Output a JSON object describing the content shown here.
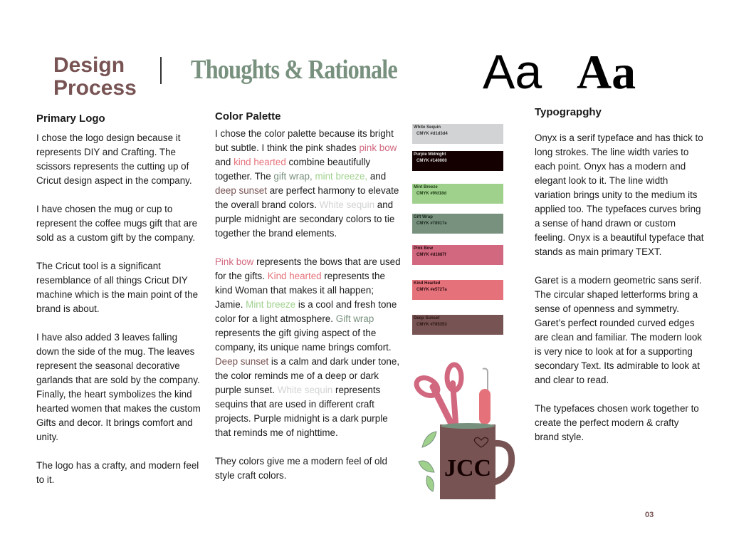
{
  "header": {
    "title_line1": "Design",
    "title_line2": "Process",
    "subtitle": "Thoughts & Rationale",
    "type_sample_sans": "Aa",
    "type_sample_serif": "Aa"
  },
  "primary_logo": {
    "heading": "Primary Logo",
    "paragraphs": [
      [
        {
          "t": "I chose the logo design because it represents DIY and Crafting. The scissors represents the cutting up of Cricut design aspect in the company."
        }
      ],
      [
        {
          "t": "I have chosen the mug or cup to represent the coffee mugs gift that are sold as a custom gift by the company."
        }
      ],
      [
        {
          "t": "The Cricut tool is a significant resemblance of all things Cricut DIY machine which is the main point of the brand is about."
        }
      ],
      [
        {
          "t": " I have also added 3 leaves falling down the side of the mug. The leaves represent the seasonal decorative garlands that are sold by the company. Finally, the heart symbolizes the kind hearted women that makes the custom Gifts and decor. It brings comfort and unity."
        }
      ],
      [
        {
          "t": "The logo has a crafty, and modern feel to it."
        }
      ]
    ]
  },
  "color_palette": {
    "heading": "Color Palette",
    "paragraphs": [
      [
        {
          "t": "I chose the color palette because its bright but subtle. I think the pink shades "
        },
        {
          "t": "pink bow",
          "c": "#d1687f"
        },
        {
          "t": " and "
        },
        {
          "t": "kind hearted",
          "c": "#e5727a"
        },
        {
          "t": " combine beautifully together. The "
        },
        {
          "t": "gift wrap,",
          "c": "#78917e"
        },
        {
          "t": " "
        },
        {
          "t": "mint breeze,",
          "c": "#9fd18d"
        },
        {
          "t": " and "
        },
        {
          "t": "deep sunset",
          "c": "#785353"
        },
        {
          "t": " are perfect harmony to elevate the overall brand colors. "
        },
        {
          "t": "White sequin",
          "c": "#d1d3d4"
        },
        {
          "t": " and purple midnight are secondary colors to tie together the brand elements."
        }
      ],
      [
        {
          "t": "Pink bow",
          "c": "#d1687f"
        },
        {
          "t": " represents the bows that are used for the gifts. "
        },
        {
          "t": "Kind hearted",
          "c": "#e5727a"
        },
        {
          "t": " represents the kind Woman that makes it all happen; Jamie. "
        },
        {
          "t": "Mint breeze",
          "c": "#9fd18d"
        },
        {
          "t": " is a cool and fresh tone color for a light atmosphere. "
        },
        {
          "t": "Gift wrap",
          "c": "#78917e"
        },
        {
          "t": " represents the gift giving aspect of the company, its unique name brings comfort. "
        },
        {
          "t": "Deep sunset",
          "c": "#785353"
        },
        {
          "t": " is a calm and dark under tone, the color reminds me of a deep or dark purple sunset. "
        },
        {
          "t": "White sequin",
          "c": "#d1d3d4"
        },
        {
          "t": " represents sequins that are used in different craft projects. Purple midnight is a dark purple that reminds me of nighttime."
        }
      ],
      [
        {
          "t": "They colors give me a modern feel of old style craft colors."
        }
      ]
    ]
  },
  "swatches": [
    {
      "name": "White Sequin",
      "code": "CMYK #d1d3d4",
      "color": "#d1d3d4",
      "text": "#333333"
    },
    {
      "name": "Purple Midnight",
      "code": "CMYK #140000",
      "color": "#140000",
      "text": "#e0e0e0"
    },
    {
      "name": "Mint Breeze",
      "code": "CMYK #9fd18d",
      "color": "#9fd18d",
      "text": "#1c3a12"
    },
    {
      "name": "Gift Wrap",
      "code": "CMYK #78917e",
      "color": "#78917e",
      "text": "#1c2a20"
    },
    {
      "name": "Pink Bow",
      "code": "CMYK #d1687f",
      "color": "#d1687f",
      "text": "#2a0a10"
    },
    {
      "name": "Kind Hearted",
      "code": "CMYK #e5727a",
      "color": "#e5727a",
      "text": "#2a0a10"
    },
    {
      "name": "Deep Sunset",
      "code": "CMYK #785353",
      "color": "#785353",
      "text": "#2a1414"
    }
  ],
  "logo": {
    "lettering": "JCC"
  },
  "typography": {
    "heading": "Typograpghy",
    "paragraphs": [
      [
        {
          "t": "Onyx is a serif typeface and has thick to long strokes. The line width varies to each point. Onyx has a modern and elegant look to it. The line width variation brings unity to the medium its applied too. The typefaces curves bring a sense of hand drawn or custom feeling. Onyx is a beautiful typeface that stands as main primary TEXT."
        }
      ],
      [
        {
          "t": "Garet is a modern geometric sans serif.  The circular shaped letterforms bring a sense of openness and symmetry. Garet’s perfect rounded curved edges are clean and familiar. The modern look is very nice to look at for a supporting secondary Text. Its admirable to look at and clear to read."
        }
      ],
      [
        {
          "t": "The typefaces chosen work together to create the perfect modern & crafty brand style."
        }
      ]
    ]
  },
  "page_number": "03"
}
